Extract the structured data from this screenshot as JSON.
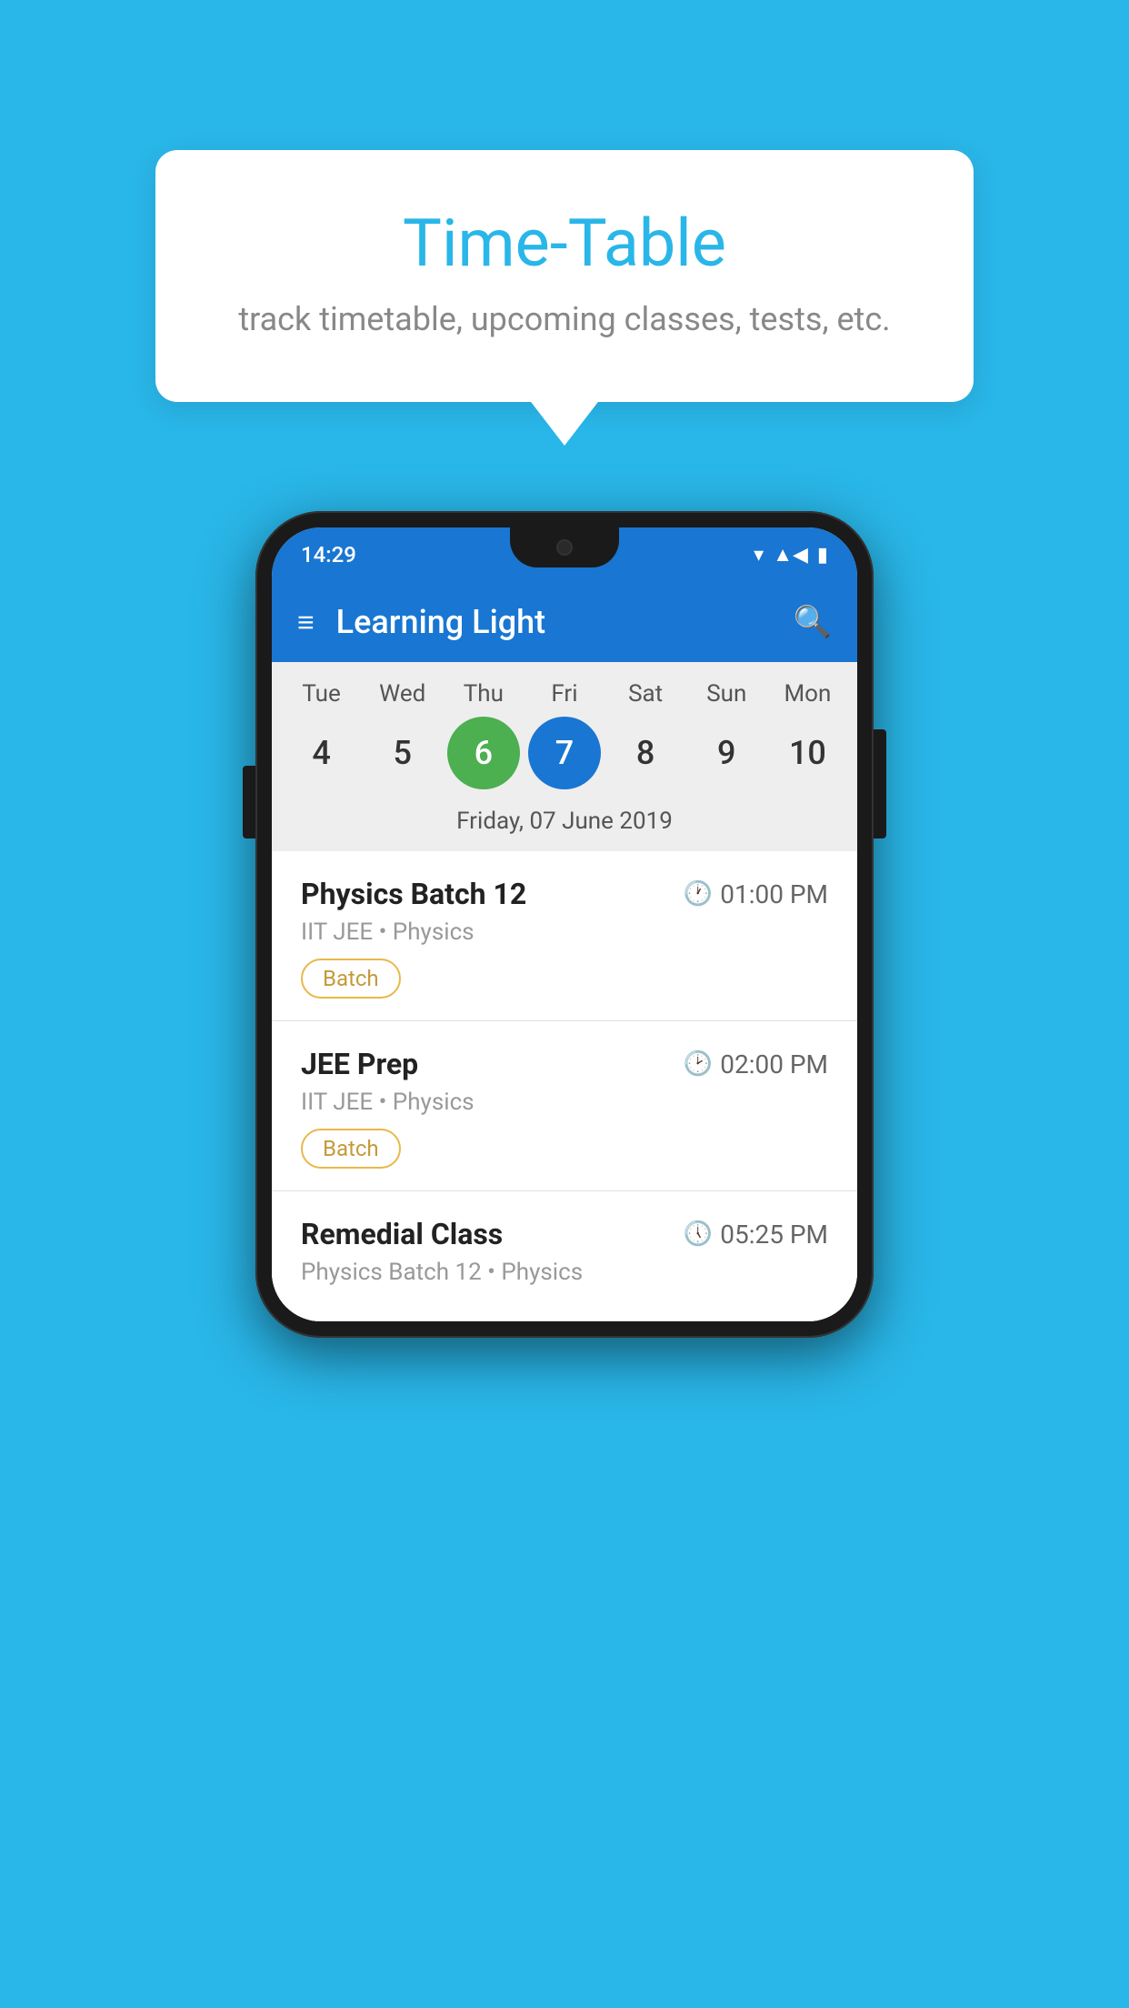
{
  "background_color": "#29B6E8",
  "bubble": {
    "title": "Time-Table",
    "subtitle": "track timetable, upcoming classes, tests, etc."
  },
  "status_bar": {
    "time": "14:29"
  },
  "app_bar": {
    "title": "Learning Light",
    "menu_label": "☰",
    "search_label": "🔍"
  },
  "calendar": {
    "days": [
      {
        "label": "Tue",
        "number": "4",
        "state": "normal"
      },
      {
        "label": "Wed",
        "number": "5",
        "state": "normal"
      },
      {
        "label": "Thu",
        "number": "6",
        "state": "today"
      },
      {
        "label": "Fri",
        "number": "7",
        "state": "selected"
      },
      {
        "label": "Sat",
        "number": "8",
        "state": "normal"
      },
      {
        "label": "Sun",
        "number": "9",
        "state": "normal"
      },
      {
        "label": "Mon",
        "number": "10",
        "state": "normal"
      }
    ],
    "selected_date_label": "Friday, 07 June 2019"
  },
  "schedule": {
    "items": [
      {
        "name": "Physics Batch 12",
        "time": "01:00 PM",
        "meta": "IIT JEE • Physics",
        "badge": "Batch"
      },
      {
        "name": "JEE Prep",
        "time": "02:00 PM",
        "meta": "IIT JEE • Physics",
        "badge": "Batch"
      },
      {
        "name": "Remedial Class",
        "time": "05:25 PM",
        "meta": "Physics Batch 12 • Physics",
        "badge": null
      }
    ]
  }
}
